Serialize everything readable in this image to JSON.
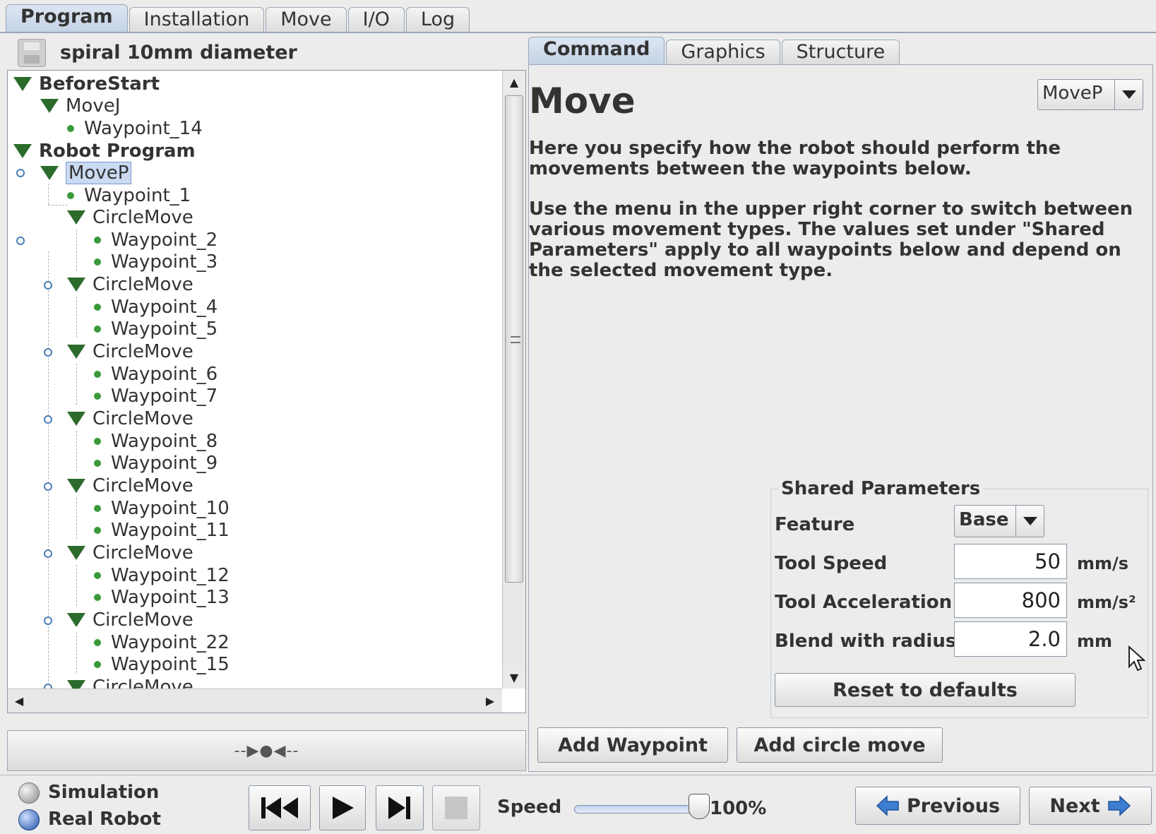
{
  "top_tabs": [
    "Program",
    "Installation",
    "Move",
    "I/O",
    "Log"
  ],
  "program": {
    "name": "spiral 10mm diameter"
  },
  "tree": {
    "before_start": "BeforeStart",
    "movej": "MoveJ",
    "waypoint_14": "Waypoint_14",
    "robot_program": "Robot Program",
    "movep": "MoveP",
    "waypoint_1": "Waypoint_1",
    "circlemove": "CircleMove",
    "circle_moves": [
      {
        "a": "Waypoint_2",
        "b": "Waypoint_3"
      },
      {
        "a": "Waypoint_4",
        "b": "Waypoint_5"
      },
      {
        "a": "Waypoint_6",
        "b": "Waypoint_7"
      },
      {
        "a": "Waypoint_8",
        "b": "Waypoint_9"
      },
      {
        "a": "Waypoint_10",
        "b": "Waypoint_11"
      },
      {
        "a": "Waypoint_12",
        "b": "Waypoint_13"
      },
      {
        "a": "Waypoint_22",
        "b": "Waypoint_15"
      }
    ]
  },
  "left_toolbar_symbol": "--▶●◀--",
  "right_tabs": [
    "Command",
    "Graphics",
    "Structure"
  ],
  "command": {
    "title": "Move",
    "move_type": "MoveP",
    "description_1": "Here you specify how the robot should perform the movements between the waypoints below.",
    "description_2": "Use the menu in the upper right corner to switch between various movement types. The values set under \"Shared Parameters\" apply to all waypoints below and depend on the selected movement type."
  },
  "shared": {
    "title": "Shared Parameters",
    "feature_label": "Feature",
    "feature_value": "Base",
    "speed_label": "Tool Speed",
    "speed_value": "50",
    "speed_unit": "mm/s",
    "accel_label": "Tool Acceleration",
    "accel_value": "800",
    "accel_unit": "mm/s²",
    "blend_label": "Blend with radius",
    "blend_value": "2.0",
    "blend_unit": "mm",
    "reset_label": "Reset to defaults"
  },
  "buttons": {
    "add_waypoint": "Add Waypoint",
    "add_circle": "Add circle move"
  },
  "bottom": {
    "simulation": "Simulation",
    "real_robot": "Real Robot",
    "speed_label": "Speed",
    "speed_percent": "100%",
    "speed_fraction": 1.0,
    "previous": "Previous",
    "next": "Next"
  },
  "icons": {
    "save": "disk-icon",
    "rewind": "skip-back-icon",
    "play": "play-icon",
    "step": "step-forward-icon",
    "stop": "stop-icon",
    "prev": "arrow-left-icon",
    "next": "arrow-right-icon"
  },
  "colors": {
    "accent": "#4a7fb5",
    "node_green": "#3a9a3a",
    "triangle": "#2c6b2c",
    "selected": "#c9daf1"
  }
}
